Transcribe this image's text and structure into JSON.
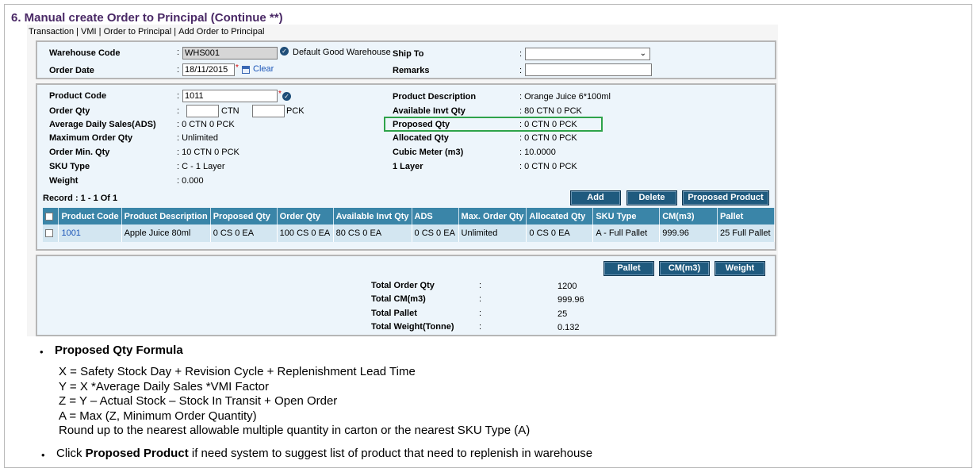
{
  "slide_title": "6. Manual create Order to Principal (Continue **)",
  "breadcrumb": [
    "Transaction",
    "VMI",
    "Order to Principal",
    "Add Order to Principal"
  ],
  "header": {
    "warehouse_code_label": "Warehouse Code",
    "warehouse_code_value": "WHS001",
    "warehouse_name": "Default Good Warehouse",
    "order_date_label": "Order Date",
    "order_date_value": "18/11/2015",
    "clear_label": "Clear",
    "ship_to_label": "Ship To",
    "ship_to_value": "",
    "remarks_label": "Remarks",
    "remarks_value": "",
    "colon": ":",
    "required_mark": "*"
  },
  "product": {
    "product_code_label": "Product Code",
    "product_code_value": "1011",
    "order_qty_label": "Order Qty",
    "ctn_unit": "CTN",
    "pck_unit": "PCK",
    "ads_label": "Average Daily Sales(ADS)",
    "ads_value": ": 0 CTN 0 PCK",
    "max_order_label": "Maximum Order Qty",
    "max_order_value": ": Unlimited",
    "min_order_label": "Order Min. Qty",
    "min_order_value": ": 10 CTN 0 PCK",
    "sku_type_label": "SKU Type",
    "sku_type_value": ": C - 1 Layer",
    "weight_label": "Weight",
    "weight_value": ": 0.000",
    "desc_label": "Product Description",
    "desc_value": ": Orange Juice 6*100ml",
    "avail_label": "Available Invt Qty",
    "avail_value": ": 80 CTN 0 PCK",
    "proposed_label": "Proposed Qty",
    "proposed_value": ": 0 CTN 0 PCK",
    "allocated_label": "Allocated Qty",
    "allocated_value": ": 0 CTN 0 PCK",
    "cubic_label": "Cubic Meter (m3)",
    "cubic_value": ": 10.0000",
    "layer_label": "1 Layer",
    "layer_value": ": 0 CTN 0 PCK"
  },
  "record_text": "Record : 1 - 1 Of 1",
  "buttons": {
    "add": "Add",
    "delete": "Delete",
    "proposed_product": "Proposed Product",
    "pallet": "Pallet",
    "cm": "CM(m3)",
    "weight": "Weight"
  },
  "table": {
    "headers": [
      "Product Code",
      "Product Description",
      "Proposed Qty",
      "Order Qty",
      "Available Invt Qty",
      "ADS",
      "Max. Order Qty",
      "Allocated Qty",
      "SKU Type",
      "CM(m3)",
      "Pallet"
    ],
    "rows": [
      [
        "1001",
        "Apple Juice 80ml",
        "0 CS 0 EA",
        "100 CS 0 EA",
        "80 CS 0 EA",
        "0 CS 0 EA",
        "Unlimited",
        "0 CS 0 EA",
        "A - Full Pallet",
        "999.96",
        "25 Full Pallet"
      ]
    ]
  },
  "totals": {
    "order_qty_label": "Total Order Qty",
    "order_qty_value": "1200",
    "cm_label": "Total CM(m3)",
    "cm_value": "999.96",
    "pallet_label": "Total Pallet",
    "pallet_value": "25",
    "weight_label": "Total Weight(Tonne)",
    "weight_value": "0.132",
    "colon": ":"
  },
  "notes": {
    "formula_title": "Proposed Qty Formula",
    "formula_lines": [
      "X = Safety Stock Day + Revision Cycle + Replenishment Lead Time",
      "Y = X *Average Daily Sales *VMI Factor",
      "Z = Y – Actual Stock – Stock In Transit + Open Order",
      "A = Max (Z, Minimum Order Quantity)",
      "Round up to the nearest allowable multiple quantity in carton or the nearest SKU Type (A)"
    ],
    "click_prefix": "Click ",
    "click_bold": "Proposed Product",
    "click_suffix": " if need system to suggest list of product that need to replenish in warehouse",
    "bullet_char": "•"
  },
  "colors": {
    "title": "#4a2966",
    "button": "#1f5a7e",
    "table_header": "#3a85a8",
    "row_bg": "#d3e6f1",
    "highlight_box": "#2ea34a",
    "link": "#1c56b8"
  }
}
